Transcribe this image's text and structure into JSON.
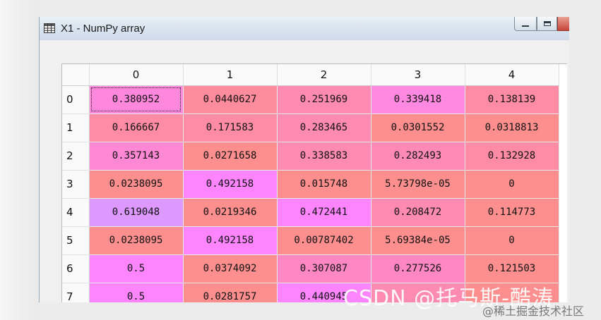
{
  "window": {
    "title": "X1 - NumPy array",
    "icon": "table-icon",
    "controls": [
      "minimize-icon",
      "maximize-icon",
      "close-icon"
    ]
  },
  "grid": {
    "column_headers": [
      "0",
      "1",
      "2",
      "3",
      "4"
    ],
    "row_headers": [
      "0",
      "1",
      "2",
      "3",
      "4",
      "5",
      "6",
      "7"
    ],
    "selected_cell": [
      0,
      0
    ],
    "rows": [
      [
        "0.380952",
        "0.0440627",
        "0.251969",
        "0.339418",
        "0.138139"
      ],
      [
        "0.166667",
        "0.171583",
        "0.283465",
        "0.0301552",
        "0.0318813"
      ],
      [
        "0.357143",
        "0.0271658",
        "0.338583",
        "0.282493",
        "0.132928"
      ],
      [
        "0.0238095",
        "0.492158",
        "0.015748",
        "5.73798e-05",
        "0"
      ],
      [
        "0.619048",
        "0.0219346",
        "0.472441",
        "0.208472",
        "0.114773"
      ],
      [
        "0.0238095",
        "0.492158",
        "0.00787402",
        "5.69384e-05",
        "0"
      ],
      [
        "0.5",
        "0.0374092",
        "0.307087",
        "0.277526",
        "0.121503"
      ],
      [
        "0.5",
        "0.0281757",
        "0.440945",
        "",
        ""
      ]
    ],
    "cell_colors": [
      [
        "#ff88dd",
        "#ff8c9c",
        "#ff8ab2",
        "#ff88e0",
        "#ff8ca4"
      ],
      [
        "#ff8ca4",
        "#ff8ca4",
        "#ff8ab2",
        "#ff8f8f",
        "#ff8f8f"
      ],
      [
        "#ff88d4",
        "#ff8f8f",
        "#ff8ab2",
        "#ff8ab6",
        "#ff8ca4"
      ],
      [
        "#ff8f8f",
        "#ff85ff",
        "#ff8f8f",
        "#ff8f8f",
        "#ff8f8f"
      ],
      [
        "#dd99ff",
        "#ff8f8f",
        "#ff85ff",
        "#ff8ab2",
        "#ff8f8f"
      ],
      [
        "#ff8f8f",
        "#ff85ff",
        "#ff8f8f",
        "#ff8f8f",
        "#ff8f8f"
      ],
      [
        "#ff85ff",
        "#ff8f8f",
        "#ff88c4",
        "#ff88c4",
        "#ff8f8f"
      ],
      [
        "#ff85ff",
        "#ff8f8f",
        "#ff85ff",
        "#ff8ab2",
        "#ff8f8f"
      ]
    ]
  },
  "watermarks": {
    "primary": "CSDN @托马斯-酷涛",
    "secondary": "@稀土掘金技术社区"
  }
}
